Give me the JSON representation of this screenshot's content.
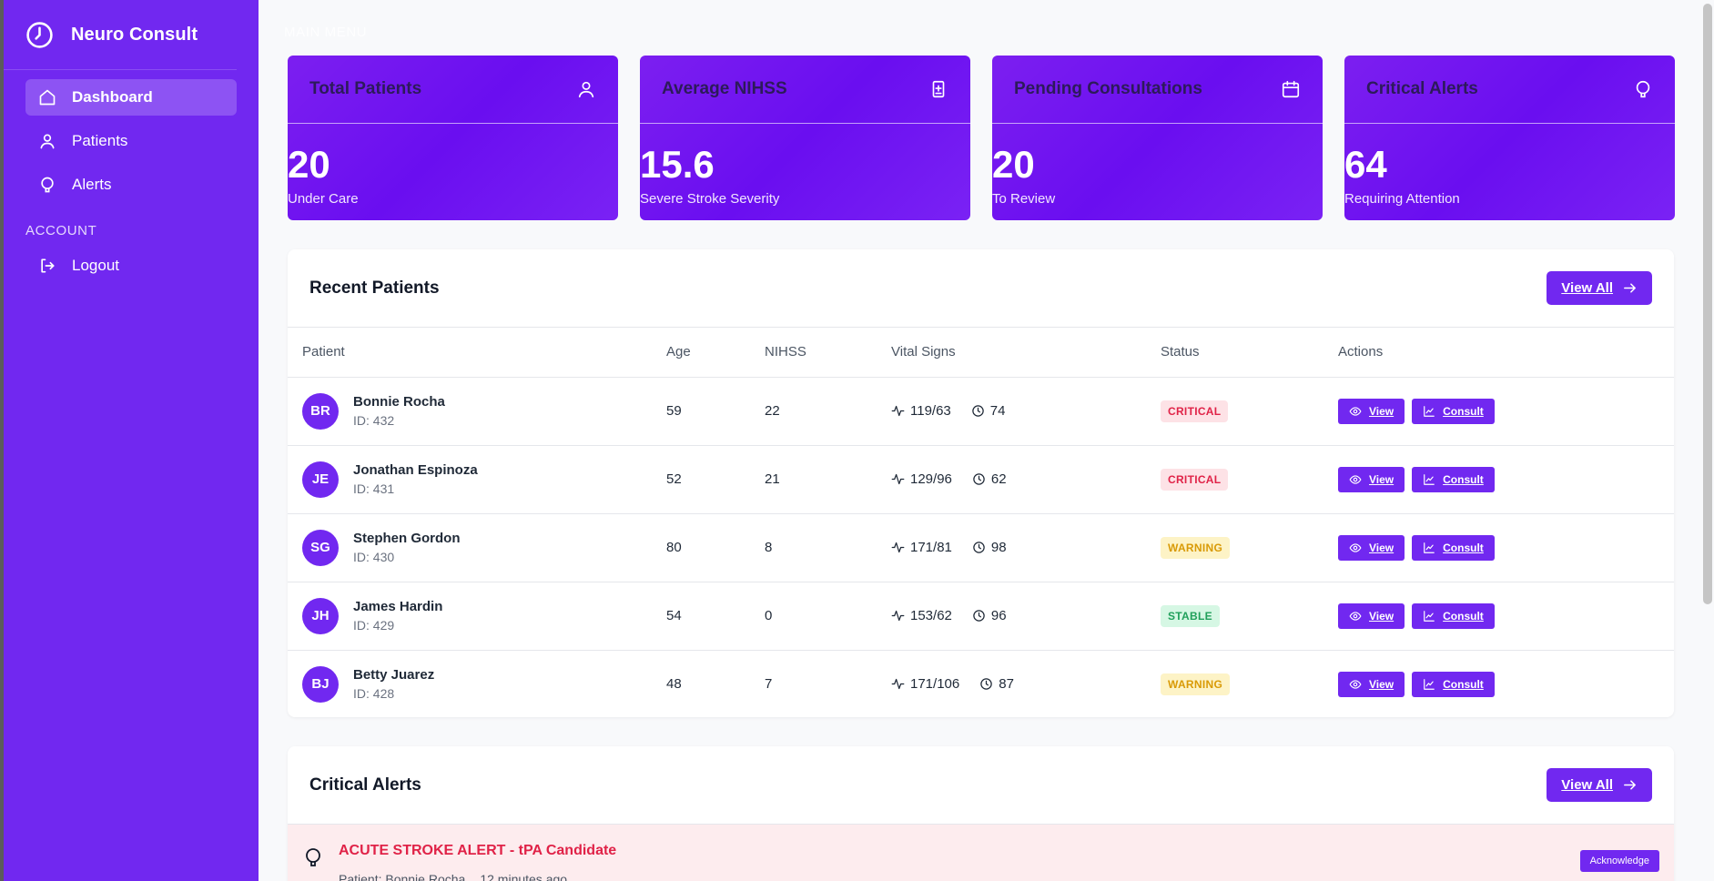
{
  "app": {
    "brand": "Neuro Consult",
    "brand_icon": "clock-icon",
    "accent": "#7128f0"
  },
  "sidebar": {
    "main_menu_label": "MAIN MENU",
    "account_label": "ACCOUNT",
    "items": [
      {
        "label": "Dashboard",
        "icon": "home-icon",
        "active": true
      },
      {
        "label": "Patients",
        "icon": "user-icon"
      },
      {
        "label": "Alerts",
        "icon": "bell-icon"
      }
    ],
    "account_items": [
      {
        "label": "Logout",
        "icon": "logout-icon"
      }
    ]
  },
  "stats": [
    {
      "title": "Total Patients",
      "value": "20",
      "subtitle": "Under Care",
      "icon": "user-icon"
    },
    {
      "title": "Average NIHSS",
      "value": "15.6",
      "subtitle": "Severe Stroke Severity",
      "icon": "score-icon"
    },
    {
      "title": "Pending Consultations",
      "value": "20",
      "subtitle": "To Review",
      "icon": "calendar-icon"
    },
    {
      "title": "Critical Alerts",
      "value": "64",
      "subtitle": "Requiring Attention",
      "icon": "bell-icon"
    }
  ],
  "recent_patients": {
    "title": "Recent Patients",
    "view_all": "View All",
    "columns": [
      "Patient",
      "Age",
      "NIHSS",
      "Vital Signs",
      "Status",
      "Actions"
    ],
    "view_label": "View",
    "consult_label": "Consult",
    "rows": [
      {
        "initials": "BR",
        "name": "Bonnie Rocha",
        "id": "ID: 432",
        "age": "59",
        "nihss": "22",
        "bp": "119/63",
        "hr": "74",
        "status": "CRITICAL",
        "status_color": "#e02247"
      },
      {
        "initials": "JE",
        "name": "Jonathan Espinoza",
        "id": "ID: 431",
        "age": "52",
        "nihss": "21",
        "bp": "129/96",
        "hr": "62",
        "status": "CRITICAL",
        "status_color": "#e02247"
      },
      {
        "initials": "SG",
        "name": "Stephen Gordon",
        "id": "ID: 430",
        "age": "80",
        "nihss": "8",
        "bp": "171/81",
        "hr": "98",
        "status": "WARNING",
        "status_color": "#d99a06"
      },
      {
        "initials": "JH",
        "name": "James Hardin",
        "id": "ID: 429",
        "age": "54",
        "nihss": "0",
        "bp": "153/62",
        "hr": "96",
        "status": "STABLE",
        "status_color": "#21a05b"
      },
      {
        "initials": "BJ",
        "name": "Betty Juarez",
        "id": "ID: 428",
        "age": "48",
        "nihss": "7",
        "bp": "171/106",
        "hr": "87",
        "status": "WARNING",
        "status_color": "#d99a06"
      }
    ]
  },
  "critical_alerts": {
    "title": "Critical Alerts",
    "view_all": "View All",
    "items": [
      {
        "title": "ACUTE STROKE ALERT - tPA Candidate",
        "patient": "Patient: Bonnie Rocha",
        "time": "12 minutes ago",
        "action": "Acknowledge"
      }
    ]
  }
}
